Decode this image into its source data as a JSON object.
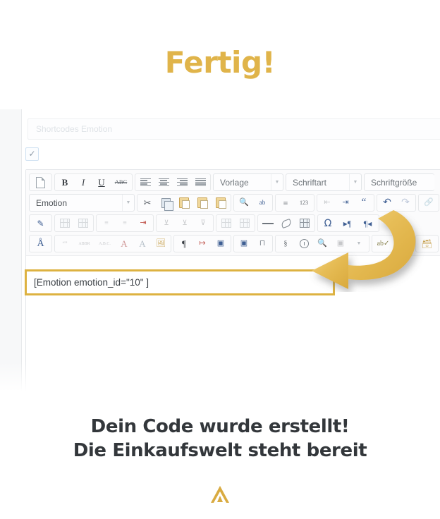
{
  "heading": "Fertig!",
  "editor": {
    "title_field": {
      "placeholder": "Shortcodes Emotion",
      "value": ""
    },
    "checkbox": {
      "checked": true,
      "glyph": "✓"
    },
    "toolbar_rows": [
      {
        "groups": [
          {
            "buttons": [
              {
                "name": "new-document-icon",
                "label": ""
              }
            ]
          },
          {
            "buttons": [
              {
                "name": "bold-button",
                "label": "B"
              },
              {
                "name": "italic-button",
                "label": "I"
              },
              {
                "name": "underline-button",
                "label": "U"
              },
              {
                "name": "strikethrough-button",
                "label": "ABC"
              }
            ]
          },
          {
            "buttons": [
              {
                "name": "align-left-button",
                "label": ""
              },
              {
                "name": "align-center-button",
                "label": ""
              },
              {
                "name": "align-right-button",
                "label": ""
              },
              {
                "name": "align-justify-button",
                "label": ""
              }
            ]
          }
        ],
        "selects": [
          {
            "name": "format-select",
            "label": "Vorlage"
          },
          {
            "name": "fontfamily-select",
            "label": "Schriftart"
          },
          {
            "name": "fontsize-select",
            "label": "Schriftgröße"
          }
        ]
      },
      {
        "selects": [
          {
            "name": "emotion-select",
            "label": "Emotion"
          }
        ],
        "groups": [
          {
            "buttons": [
              {
                "name": "cut-icon",
                "label": "✂"
              },
              {
                "name": "copy-icon",
                "label": ""
              },
              {
                "name": "paste-icon",
                "label": ""
              },
              {
                "name": "paste-as-text-icon",
                "label": "T"
              },
              {
                "name": "paste-from-word-icon",
                "label": "W"
              }
            ]
          },
          {
            "buttons": [
              {
                "name": "find-icon",
                "label": ""
              },
              {
                "name": "replace-icon",
                "label": ""
              }
            ]
          },
          {
            "buttons": [
              {
                "name": "bullet-list-icon",
                "label": ""
              },
              {
                "name": "numbered-list-icon",
                "label": ""
              }
            ]
          },
          {
            "buttons": [
              {
                "name": "outdent-icon",
                "label": ""
              },
              {
                "name": "indent-icon",
                "label": ""
              },
              {
                "name": "blockquote-icon",
                "label": "“"
              }
            ]
          },
          {
            "buttons": [
              {
                "name": "undo-icon",
                "label": "↰"
              },
              {
                "name": "redo-icon",
                "label": "↱"
              }
            ]
          }
        ]
      },
      {
        "groups": [
          {
            "buttons": [
              {
                "name": "edit-source-icon",
                "label": ""
              }
            ]
          },
          {
            "buttons": [
              {
                "name": "insert-row-before-icon",
                "label": ""
              },
              {
                "name": "insert-row-after-icon",
                "label": ""
              }
            ]
          },
          {
            "buttons": [
              {
                "name": "list-properties-icon",
                "label": ""
              },
              {
                "name": "list-item-properties-icon",
                "label": ""
              },
              {
                "name": "remove-list-icon",
                "label": ""
              }
            ]
          },
          {
            "buttons": [
              {
                "name": "merge-cells-icon",
                "label": ""
              },
              {
                "name": "split-cell-icon",
                "label": ""
              },
              {
                "name": "cell-properties-icon",
                "label": ""
              }
            ]
          },
          {
            "buttons": [
              {
                "name": "table-row-icon",
                "label": ""
              },
              {
                "name": "table-column-icon",
                "label": ""
              }
            ]
          },
          {
            "buttons": [
              {
                "name": "horizontal-rule-icon",
                "label": ""
              },
              {
                "name": "remove-format-icon",
                "label": ""
              },
              {
                "name": "insert-table-icon",
                "label": ""
              }
            ]
          },
          {
            "buttons": [
              {
                "name": "special-character-icon",
                "label": "Ω"
              },
              {
                "name": "ltr-direction-icon",
                "label": "▸¶"
              },
              {
                "name": "rtl-direction-icon",
                "label": "¶◂"
              }
            ]
          }
        ]
      },
      {
        "groups": [
          {
            "buttons": [
              {
                "name": "font-style-icon",
                "label": "A"
              }
            ]
          },
          {
            "buttons": [
              {
                "name": "quote-style-icon",
                "label": "“”"
              },
              {
                "name": "abbreviation-icon",
                "label": "ABBR"
              },
              {
                "name": "acronym-icon",
                "label": "ABC"
              },
              {
                "name": "subscript-icon",
                "label": "A"
              },
              {
                "name": "superscript-icon",
                "label": "A"
              },
              {
                "name": "insert-image-icon",
                "label": ""
              }
            ]
          },
          {
            "buttons": [
              {
                "name": "show-blocks-icon",
                "label": "¶"
              },
              {
                "name": "nonbreaking-icon",
                "label": ""
              },
              {
                "name": "insert-layer-icon",
                "label": ""
              }
            ]
          },
          {
            "buttons": [
              {
                "name": "anchor-icon",
                "label": ""
              },
              {
                "name": "page-break-icon",
                "label": ""
              }
            ]
          },
          {
            "buttons": [
              {
                "name": "insert-date-icon",
                "label": ""
              },
              {
                "name": "insert-time-icon",
                "label": ""
              },
              {
                "name": "preview-icon",
                "label": ""
              }
            ]
          },
          {
            "buttons": [
              {
                "name": "spellcheck-icon",
                "label": "ab"
              }
            ]
          },
          {
            "buttons": [
              {
                "name": "media-icon",
                "label": ""
              }
            ]
          }
        ]
      }
    ],
    "code_field": {
      "value": "[Emotion emotion_id=\"10\" ]"
    }
  },
  "annotation": {
    "arrow_name": "curved-arrow-annotation",
    "highlight_color": "#ddb241"
  },
  "caption": {
    "line1": "Dein Code wurde erstellt!",
    "line2": "Die Einkaufswelt steht bereit"
  },
  "footer": {
    "chevron_icon": "chevron-up-icon"
  },
  "colors": {
    "gold": "#ddb241",
    "heading_gold": "#e0b44a",
    "caption_dark": "#33373b",
    "panel_bg": "#f7f8f9"
  }
}
